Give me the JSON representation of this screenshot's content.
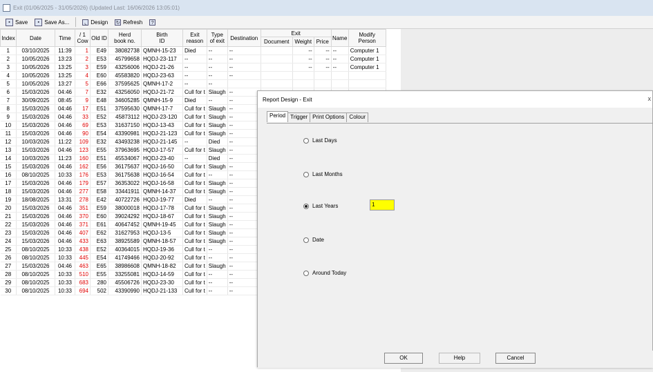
{
  "window": {
    "title": "Exit (01/06/2025 - 31/05/2026) (Updated Last: 16/06/2026 13:05:01)"
  },
  "toolbar": {
    "save": "Save",
    "save_as": "Save As...",
    "design": "Design",
    "refresh": "Refresh",
    "help_icon_label": "?"
  },
  "grid": {
    "headers": {
      "index": "Index",
      "date": "Date",
      "time": "Time",
      "cow": "/ 1\nCow",
      "old_id": "Old ID",
      "herd": "Herd\nbook no.",
      "birth": "Birth\nID",
      "exit_reason": "Exit\nreason",
      "type_exit": "Type\nof exit",
      "destination": "Destination",
      "exit_group": "Exit",
      "document": "Document",
      "weight": "Weight",
      "price": "Price",
      "name": "Name",
      "modify": "Modify\nPerson"
    },
    "rows": [
      [
        "1",
        "03/10/2025",
        "11:39",
        "1",
        "E49",
        "38082738",
        "QMNH-15-23",
        "Died",
        "--",
        "--",
        "",
        "--",
        "--",
        "--",
        "Computer 1"
      ],
      [
        "2",
        "10/05/2026",
        "13:23",
        "2",
        "E53",
        "45799658",
        "HQDJ-23-117",
        "--",
        "--",
        "--",
        "",
        "--",
        "--",
        "--",
        "Computer 1"
      ],
      [
        "3",
        "10/05/2026",
        "13:25",
        "3",
        "E59",
        "43256006",
        "HQDJ-21-26",
        "--",
        "--",
        "--",
        "",
        "--",
        "--",
        "--",
        "Computer 1"
      ],
      [
        "4",
        "10/05/2026",
        "13:25",
        "4",
        "E60",
        "45583820",
        "HQDJ-23-63",
        "--",
        "--",
        "--",
        "",
        "",
        "",
        "",
        ""
      ],
      [
        "5",
        "10/05/2026",
        "13:27",
        "5",
        "E66",
        "37595625",
        "QMNH-17-2",
        "--",
        "--",
        "",
        "",
        "",
        "",
        "",
        ""
      ],
      [
        "6",
        "15/03/2026",
        "04:46",
        "7",
        "E32",
        "43256050",
        "HQDJ-21-72",
        "Cull for t",
        "Slaugh",
        "--",
        "",
        "",
        "",
        "",
        ""
      ],
      [
        "7",
        "30/09/2025",
        "08:45",
        "9",
        "E48",
        "34605285",
        "QMNH-15-9",
        "Died",
        "--",
        "--",
        "",
        "",
        "",
        "",
        ""
      ],
      [
        "8",
        "15/03/2026",
        "04:46",
        "17",
        "E51",
        "37595630",
        "QMNH-17-7",
        "Cull for t",
        "Slaugh",
        "--",
        "",
        "",
        "",
        "",
        ""
      ],
      [
        "9",
        "15/03/2026",
        "04:46",
        "33",
        "E52",
        "45873112",
        "HQDJ-23-120",
        "Cull for t",
        "Slaugh",
        "--",
        "",
        "",
        "",
        "",
        ""
      ],
      [
        "10",
        "15/03/2026",
        "04:46",
        "69",
        "E53",
        "31637150",
        "HQDJ-13-43",
        "Cull for t",
        "Slaugh",
        "--",
        "",
        "",
        "",
        "",
        ""
      ],
      [
        "11",
        "15/03/2026",
        "04:46",
        "90",
        "E54",
        "43390981",
        "HQDJ-21-123",
        "Cull for t",
        "Slaugh",
        "--",
        "",
        "",
        "",
        "",
        ""
      ],
      [
        "12",
        "10/03/2026",
        "11:22",
        "109",
        "E32",
        "43493238",
        "HQDJ-21-145",
        "--",
        "Died",
        "--",
        "",
        "",
        "",
        "",
        ""
      ],
      [
        "13",
        "15/03/2026",
        "04:46",
        "123",
        "E55",
        "37963695",
        "HQDJ-17-57",
        "Cull for t",
        "Slaugh",
        "--",
        "",
        "",
        "",
        "",
        ""
      ],
      [
        "14",
        "10/03/2026",
        "11:23",
        "160",
        "E51",
        "45534067",
        "HQDJ-23-40",
        "--",
        "Died",
        "--",
        "",
        "",
        "",
        "",
        ""
      ],
      [
        "15",
        "15/03/2026",
        "04:46",
        "162",
        "E56",
        "36175637",
        "HQDJ-16-50",
        "Cull for t",
        "Slaugh",
        "--",
        "",
        "",
        "",
        "",
        ""
      ],
      [
        "16",
        "08/10/2025",
        "10:33",
        "176",
        "E53",
        "36175638",
        "HQDJ-16-54",
        "Cull for t",
        "--",
        "--",
        "",
        "",
        "",
        "",
        ""
      ],
      [
        "17",
        "15/03/2026",
        "04:46",
        "179",
        "E57",
        "36353022",
        "HQDJ-16-58",
        "Cull for t",
        "Slaugh",
        "--",
        "",
        "",
        "",
        "",
        ""
      ],
      [
        "18",
        "15/03/2026",
        "04:46",
        "277",
        "E58",
        "33441911",
        "QMNH-14-37",
        "Cull for t",
        "Slaugh",
        "--",
        "",
        "",
        "",
        "",
        ""
      ],
      [
        "19",
        "18/08/2025",
        "13:31",
        "278",
        "E42",
        "40722726",
        "HQDJ-19-77",
        "Died",
        "--",
        "--",
        "",
        "",
        "",
        "",
        ""
      ],
      [
        "20",
        "15/03/2026",
        "04:46",
        "351",
        "E59",
        "38000018",
        "HQDJ-17-78",
        "Cull for t",
        "Slaugh",
        "--",
        "",
        "",
        "",
        "",
        ""
      ],
      [
        "21",
        "15/03/2026",
        "04:46",
        "370",
        "E60",
        "39024292",
        "HQDJ-18-67",
        "Cull for t",
        "Slaugh",
        "--",
        "",
        "",
        "",
        "",
        ""
      ],
      [
        "22",
        "15/03/2026",
        "04:46",
        "371",
        "E61",
        "40647452",
        "QMNH-19-45",
        "Cull for t",
        "Slaugh",
        "--",
        "",
        "",
        "",
        "",
        ""
      ],
      [
        "23",
        "15/03/2026",
        "04:46",
        "407",
        "E62",
        "31627953",
        "HQDJ-13-5",
        "Cull for t",
        "Slaugh",
        "--",
        "",
        "",
        "",
        "",
        ""
      ],
      [
        "24",
        "15/03/2026",
        "04:46",
        "433",
        "E63",
        "38925589",
        "QMNH-18-57",
        "Cull for t",
        "Slaugh",
        "--",
        "",
        "",
        "",
        "",
        ""
      ],
      [
        "25",
        "08/10/2025",
        "10:33",
        "438",
        "E52",
        "40364015",
        "HQDJ-19-36",
        "Cull for t",
        "--",
        "--",
        "",
        "",
        "",
        "",
        ""
      ],
      [
        "26",
        "08/10/2025",
        "10:33",
        "445",
        "E54",
        "41749466",
        "HQDJ-20-92",
        "Cull for t",
        "--",
        "--",
        "",
        "",
        "",
        "",
        ""
      ],
      [
        "27",
        "15/03/2026",
        "04:46",
        "463",
        "E65",
        "38986608",
        "QMNH-18-82",
        "Cull for t",
        "Slaugh",
        "--",
        "",
        "",
        "",
        "",
        ""
      ],
      [
        "28",
        "08/10/2025",
        "10:33",
        "510",
        "E55",
        "33255081",
        "HQDJ-14-59",
        "Cull for t",
        "--",
        "--",
        "",
        "",
        "",
        "",
        ""
      ],
      [
        "29",
        "08/10/2025",
        "10:33",
        "683",
        "280",
        "45506726",
        "HQDJ-23-30",
        "Cull for t",
        "--",
        "--",
        "",
        "",
        "",
        "",
        ""
      ],
      [
        "30",
        "08/10/2025",
        "10:33",
        "694",
        "502",
        "43390990",
        "HQDJ-21-133",
        "Cull for t",
        "--",
        "--",
        "",
        "",
        "",
        "",
        ""
      ]
    ]
  },
  "dialog": {
    "title": "Report Design - Exit",
    "close": "x",
    "tabs": [
      "Period",
      "Trigger",
      "Print Options",
      "Colour"
    ],
    "options": [
      {
        "label": "Last Days",
        "selected": false
      },
      {
        "label": "Last Months",
        "selected": false
      },
      {
        "label": "Last Years",
        "selected": true
      },
      {
        "label": "Date",
        "selected": false
      },
      {
        "label": "Around Today",
        "selected": false
      }
    ],
    "years_value": "1",
    "buttons": {
      "ok": "OK",
      "help": "Help",
      "cancel": "Cancel"
    }
  },
  "colors": {
    "cow_number": "#e00000",
    "input_highlight": "#ffff00",
    "titlebar": "#d9e4f1"
  }
}
